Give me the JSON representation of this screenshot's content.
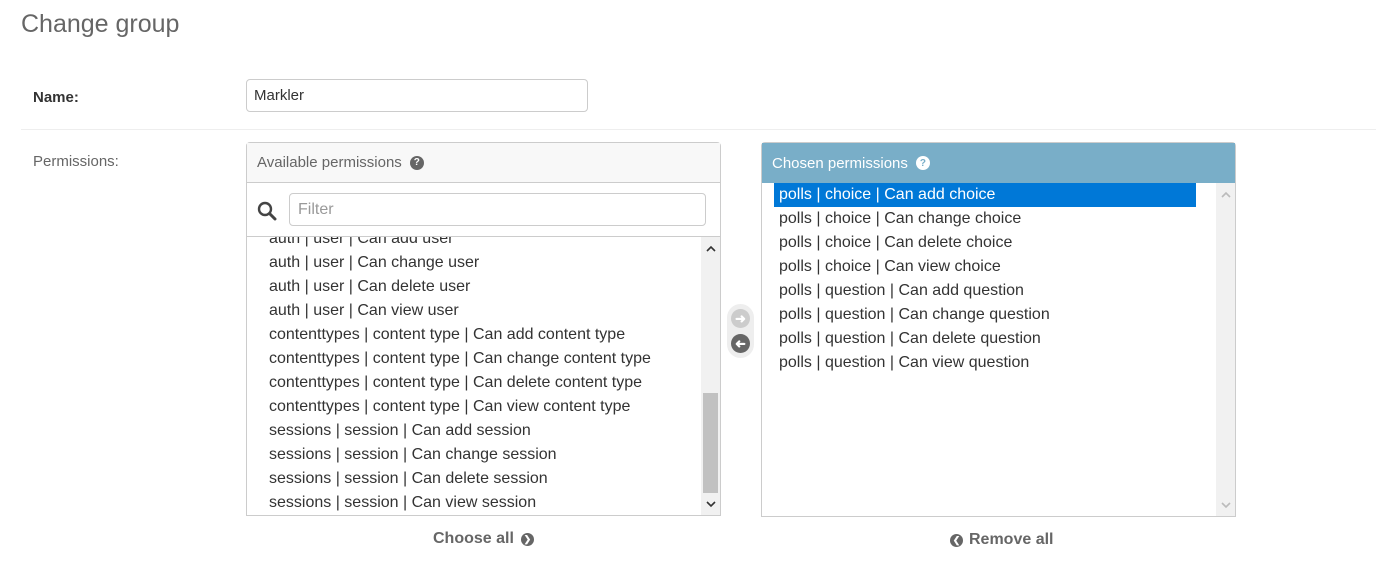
{
  "page": {
    "title": "Change group"
  },
  "name_field": {
    "label": "Name:",
    "value": "Markler"
  },
  "permissions": {
    "label": "Permissions:",
    "available": {
      "title": "Available permissions",
      "filter_placeholder": "Filter",
      "options": [
        "auth | user | Can add user",
        "auth | user | Can change user",
        "auth | user | Can delete user",
        "auth | user | Can view user",
        "contenttypes | content type | Can add content type",
        "contenttypes | content type | Can change content type",
        "contenttypes | content type | Can delete content type",
        "contenttypes | content type | Can view content type",
        "sessions | session | Can add session",
        "sessions | session | Can change session",
        "sessions | session | Can delete session",
        "sessions | session | Can view session"
      ],
      "choose_all_label": "Choose all"
    },
    "chosen": {
      "title": "Chosen permissions",
      "options": [
        "polls | choice | Can add choice",
        "polls | choice | Can change choice",
        "polls | choice | Can delete choice",
        "polls | choice | Can view choice",
        "polls | question | Can add question",
        "polls | question | Can change question",
        "polls | question | Can delete question",
        "polls | question | Can view question"
      ],
      "selected_index": 0,
      "remove_all_label": "Remove all"
    }
  },
  "icons": {
    "help": "help-circle-icon",
    "search": "search-icon",
    "add": "arrow-right-circle-icon",
    "remove": "arrow-left-circle-icon"
  },
  "colors": {
    "chosen_header": "#79aec8",
    "selection": "#0078d7"
  }
}
